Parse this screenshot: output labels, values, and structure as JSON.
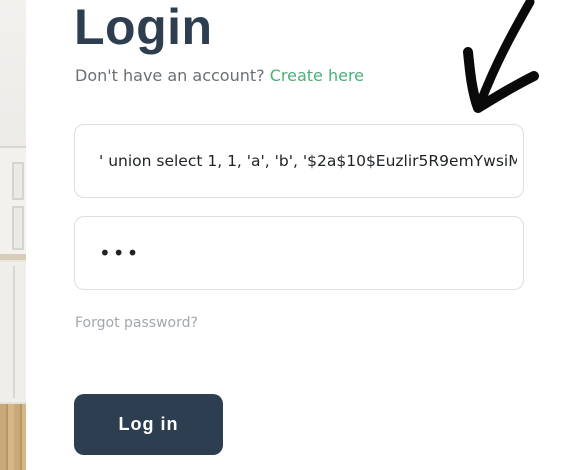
{
  "page": {
    "title": "Login"
  },
  "signup": {
    "prompt": "Don't have an account?",
    "link_label": "Create here"
  },
  "form": {
    "username_value": "' union select 1, 1, 'a', 'b', '$2a$10$Euzlir5R9emYwsiM",
    "password_value": "abc",
    "forgot_label": "Forgot password?",
    "submit_label": "Log in"
  },
  "colors": {
    "primary": "#2d3e50",
    "link": "#4caf78",
    "muted": "#a3a7ab"
  },
  "icons": {
    "annotation": "hand-drawn-arrow-icon"
  }
}
